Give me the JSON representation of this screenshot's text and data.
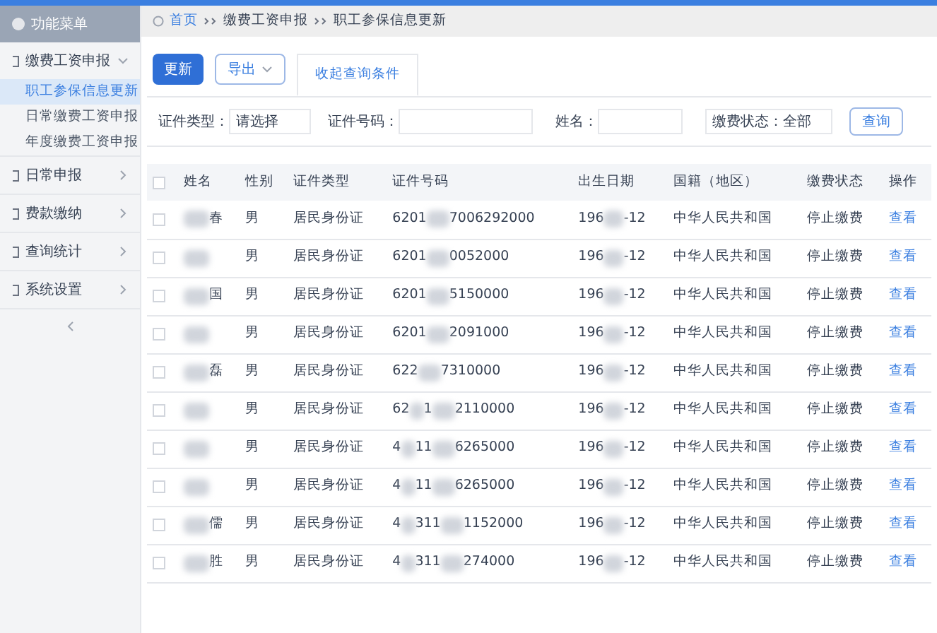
{
  "sidebar": {
    "title": "功能菜单",
    "groups": [
      {
        "label": "缴费工资申报",
        "expanded": true,
        "children": [
          {
            "label": "职工参保信息更新",
            "selected": true
          },
          {
            "label": "日常缴费工资申报",
            "selected": false
          },
          {
            "label": "年度缴费工资申报",
            "selected": false
          }
        ]
      },
      {
        "label": "日常申报",
        "expanded": false
      },
      {
        "label": "费款缴纳",
        "expanded": false
      },
      {
        "label": "查询统计",
        "expanded": false
      },
      {
        "label": "系统设置",
        "expanded": false
      }
    ]
  },
  "breadcrumb": [
    "首页",
    "缴费工资申报",
    "职工参保信息更新"
  ],
  "toolbar": {
    "update": "更新",
    "export": "导出",
    "tab": "收起查询条件"
  },
  "filters": {
    "id_type_label": "证件类型：",
    "id_type_value": "请选择",
    "id_no_label": "证件号码：",
    "name_label": "姓名：",
    "status": "缴费状态：全部",
    "query": "查询"
  },
  "table": {
    "select_all_checked": false,
    "columns": [
      "姓名",
      "性别",
      "证件类型",
      "证件号码",
      "出生日期",
      "国籍（地区）",
      "缴费状态",
      "操作"
    ],
    "rows": [
      {
        "name": "春",
        "sex": "男",
        "id_type": "居民身份证",
        "id_parts": [
          "6201",
          "7006292000"
        ],
        "birth": [
          "196",
          "-12"
        ],
        "nation": "中华人民共和国",
        "status": "停止缴费",
        "action": "查看",
        "checked": false
      },
      {
        "sex": "男",
        "id_type": "居民身份证",
        "id_parts": [
          "6201",
          "0052000"
        ],
        "birth": [
          "196",
          "-12"
        ],
        "nation": "中华人民共和国",
        "status": "停止缴费",
        "action": "查看",
        "checked": false
      },
      {
        "name": "国",
        "sex": "男",
        "id_type": "居民身份证",
        "id_parts": [
          "6201",
          "5150000"
        ],
        "birth": [
          "196",
          "-12"
        ],
        "nation": "中华人民共和国",
        "status": "停止缴费",
        "action": "查看",
        "checked": false
      },
      {
        "sex": "男",
        "id_type": "居民身份证",
        "id_parts": [
          "6201",
          "2091000"
        ],
        "birth": [
          "196",
          "-12"
        ],
        "nation": "中华人民共和国",
        "status": "停止缴费",
        "action": "查看",
        "checked": false
      },
      {
        "name": "磊",
        "sex": "男",
        "id_type": "居民身份证",
        "id_parts": [
          "622",
          "7310000"
        ],
        "birth": [
          "196",
          "-12"
        ],
        "nation": "中华人民共和国",
        "status": "停止缴费",
        "action": "查看",
        "checked": false
      },
      {
        "sex": "男",
        "id_type": "居民身份证",
        "id_parts": [
          "62",
          "1",
          "2110000"
        ],
        "birth": [
          "196",
          "-12"
        ],
        "nation": "中华人民共和国",
        "status": "停止缴费",
        "action": "查看",
        "checked": false
      },
      {
        "sex": "男",
        "id_type": "居民身份证",
        "id_parts": [
          "4",
          "11",
          "6265000"
        ],
        "birth": [
          "196",
          "-12"
        ],
        "nation": "中华人民共和国",
        "status": "停止缴费",
        "action": "查看",
        "checked": false
      },
      {
        "sex": "男",
        "id_type": "居民身份证",
        "id_parts": [
          "4",
          "11",
          "6265000"
        ],
        "birth": [
          "196",
          "-12"
        ],
        "nation": "中华人民共和国",
        "status": "停止缴费",
        "action": "查看",
        "checked": false
      },
      {
        "name": "儒",
        "sex": "男",
        "id_type": "居民身份证",
        "id_parts": [
          "4",
          "311",
          "1152000"
        ],
        "birth": [
          "196",
          "-12"
        ],
        "nation": "中华人民共和国",
        "status": "停止缴费",
        "action": "查看",
        "checked": false
      },
      {
        "name": "胜",
        "sex": "男",
        "id_type": "居民身份证",
        "id_parts": [
          "4",
          "311",
          "274000"
        ],
        "birth": [
          "196",
          "-12"
        ],
        "nation": "中华人民共和国",
        "status": "停止缴费",
        "action": "查看",
        "checked": false
      }
    ]
  }
}
